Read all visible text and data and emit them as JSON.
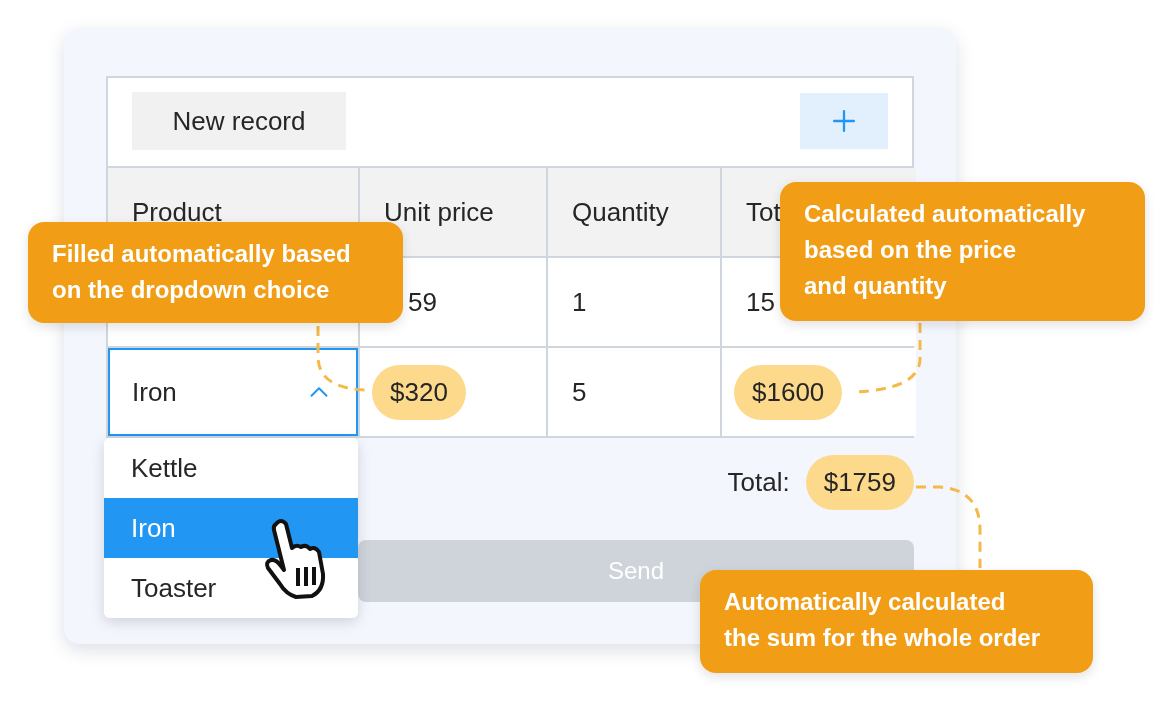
{
  "toolbar": {
    "new_record": "New record"
  },
  "table": {
    "columns": [
      "Product",
      "Unit price",
      "Quantity",
      "Tot"
    ],
    "rows": [
      {
        "unit_price": "59",
        "quantity": "1",
        "total": "15",
        "highlighted": false
      },
      {
        "product": "Iron",
        "expanded": true,
        "unit_price": "$320",
        "quantity": "5",
        "total": "$1600",
        "highlighted": true
      }
    ]
  },
  "dropdown": {
    "options": [
      {
        "label": "Kettle",
        "selected": false
      },
      {
        "label": "Iron",
        "selected": true
      },
      {
        "label": "Toaster",
        "selected": false
      }
    ]
  },
  "total": {
    "label": "Total:",
    "value": "$1759"
  },
  "send_button": {
    "label": "Send",
    "disabled": true
  },
  "callouts": [
    {
      "text": "Filled automatically based\non the dropdown choice"
    },
    {
      "text": "Calculated automatically\nbased on the price\nand quantity"
    },
    {
      "text": "Automatically calculated\nthe sum for the whole order"
    }
  ]
}
